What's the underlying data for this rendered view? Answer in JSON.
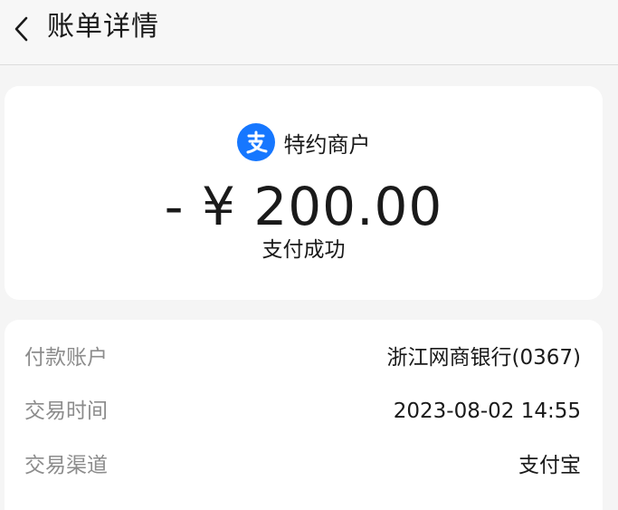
{
  "header": {
    "title": "账单详情"
  },
  "summary": {
    "merchant_icon": "alipay-icon",
    "merchant_name": "特约商户",
    "amount": "- ¥ 200.00",
    "status": "支付成功"
  },
  "details": [
    {
      "label": "付款账户",
      "value": "浙江网商银行(0367)"
    },
    {
      "label": "交易时间",
      "value": "2023-08-02 14:55"
    },
    {
      "label": "交易渠道",
      "value": "支付宝"
    }
  ],
  "colors": {
    "brand": "#1677ff",
    "background": "#f5f5f5",
    "card": "#ffffff",
    "label": "#8c8c8c"
  }
}
